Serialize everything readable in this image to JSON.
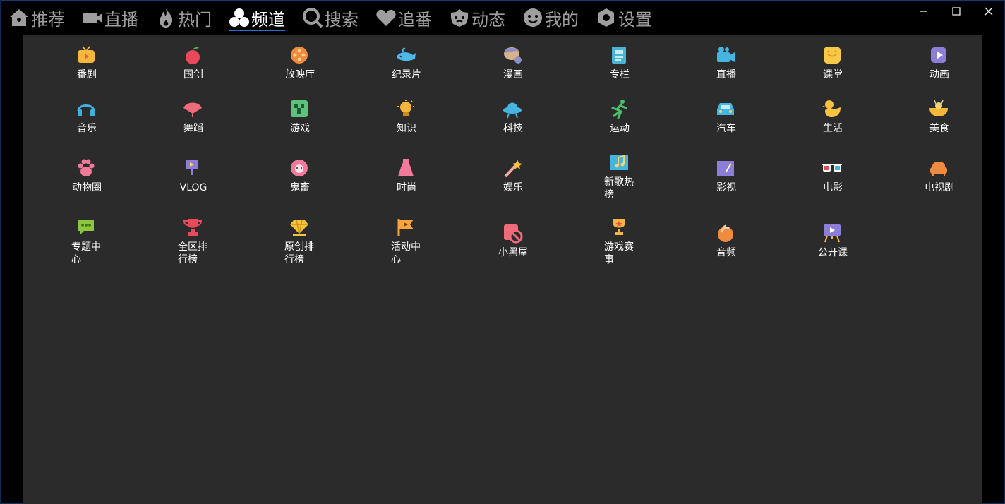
{
  "nav": {
    "items": [
      {
        "label": "推荐",
        "icon": "home-icon"
      },
      {
        "label": "直播",
        "icon": "video-camera-icon"
      },
      {
        "label": "热门",
        "icon": "flame-icon"
      },
      {
        "label": "频道",
        "icon": "channels-icon"
      },
      {
        "label": "搜索",
        "icon": "search-icon"
      },
      {
        "label": "追番",
        "icon": "heart-icon"
      },
      {
        "label": "动态",
        "icon": "moments-icon"
      },
      {
        "label": "我的",
        "icon": "smiley-icon"
      },
      {
        "label": "设置",
        "icon": "gear-icon"
      }
    ],
    "active": "频道",
    "active_color": "#2d6fd2"
  },
  "window_controls": {
    "minimize": "minimize-icon",
    "maximize": "maximize-icon",
    "close": "close-icon"
  },
  "channels": [
    {
      "label": "番剧",
      "icon": "tv-icon"
    },
    {
      "label": "国创",
      "icon": "peach-icon"
    },
    {
      "label": "放映厅",
      "icon": "film-reel-icon"
    },
    {
      "label": "纪录片",
      "icon": "whale-icon"
    },
    {
      "label": "漫画",
      "icon": "comic-icon"
    },
    {
      "label": "专栏",
      "icon": "article-icon"
    },
    {
      "label": "直播",
      "icon": "live-camera-icon"
    },
    {
      "label": "课堂",
      "icon": "classroom-icon"
    },
    {
      "label": "动画",
      "icon": "play-icon"
    },
    {
      "label": "音乐",
      "icon": "headphones-icon"
    },
    {
      "label": "舞蹈",
      "icon": "fan-icon"
    },
    {
      "label": "游戏",
      "icon": "creeper-icon"
    },
    {
      "label": "知识",
      "icon": "lightbulb-icon"
    },
    {
      "label": "科技",
      "icon": "ufo-icon"
    },
    {
      "label": "运动",
      "icon": "runner-icon"
    },
    {
      "label": "汽车",
      "icon": "car-icon"
    },
    {
      "label": "生活",
      "icon": "duck-icon"
    },
    {
      "label": "美食",
      "icon": "food-icon"
    },
    {
      "label": "动物圈",
      "icon": "paw-icon"
    },
    {
      "label": "VLOG",
      "icon": "vlog-icon"
    },
    {
      "label": "鬼畜",
      "icon": "ghost-icon"
    },
    {
      "label": "时尚",
      "icon": "dress-icon"
    },
    {
      "label": "娱乐",
      "icon": "magic-wand-icon"
    },
    {
      "label": "新歌热榜",
      "icon": "music-chart-icon"
    },
    {
      "label": "影视",
      "icon": "clapper-icon"
    },
    {
      "label": "电影",
      "icon": "3d-glasses-icon"
    },
    {
      "label": "电视剧",
      "icon": "sofa-icon"
    },
    {
      "label": "专题中心",
      "icon": "chat-bubble-icon"
    },
    {
      "label": "全区排行榜",
      "icon": "trophy-icon"
    },
    {
      "label": "原创排行榜",
      "icon": "diamond-icon"
    },
    {
      "label": "活动中心",
      "icon": "flag-icon"
    },
    {
      "label": "小黑屋",
      "icon": "ban-icon"
    },
    {
      "label": "游戏赛事",
      "icon": "cup-icon"
    },
    {
      "label": "音频",
      "icon": "audio-icon"
    },
    {
      "label": "公开课",
      "icon": "lecture-icon"
    }
  ]
}
